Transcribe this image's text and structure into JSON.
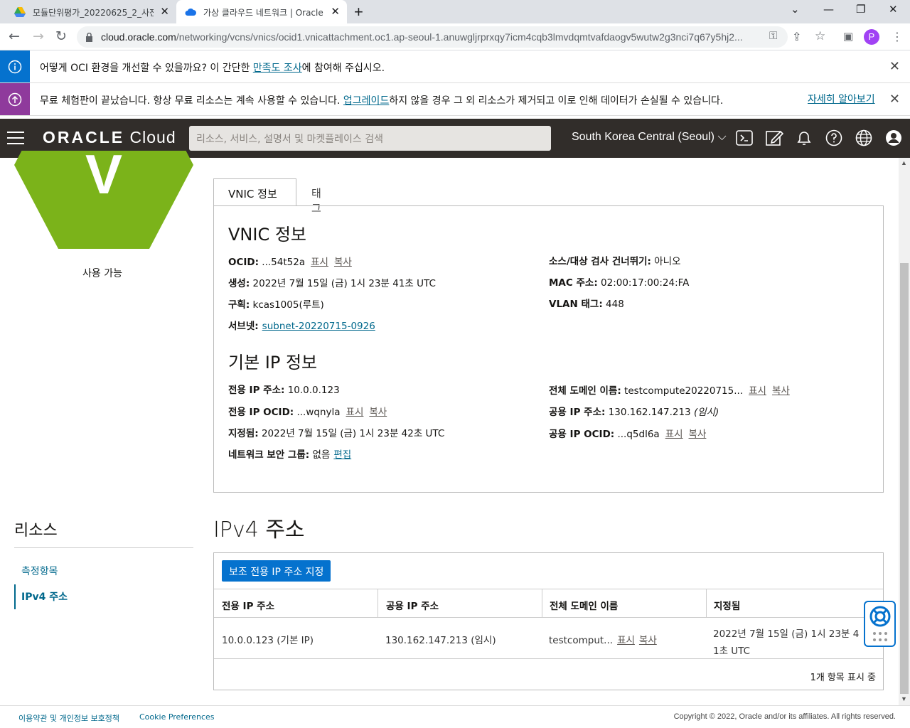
{
  "browser": {
    "tabs": [
      {
        "title": "모듈단위평가_20220625_2_사전"
      },
      {
        "title": "가상 클라우드 네트워크 | Oracle"
      }
    ],
    "url_host": "cloud.oracle.com",
    "url_rest": "/networking/vcns/vnics/ocid1.vnicattachment.oc1.ap-seoul-1.anuwgljrprxqy7icm4cqb3lmvdqmtvafdaogv5wutw2g3nci7q67y5hj2...",
    "profile_initial": "P"
  },
  "banners": {
    "survey": {
      "pre": "어떻게 OCI 환경을 개선할 수 있을까요? 이 간단한 ",
      "link": "만족도 조사",
      "post": "에 참여해 주십시오."
    },
    "trial": {
      "pre": "무료 체험판이 끝났습니다. 항상 무료 리소스는 계속 사용할 수 있습니다. ",
      "link": "업그레이드",
      "post": "하지 않을 경우 그 외 리소스가 제거되고 이로 인해 데이터가 손실될 수 있습니다.",
      "more": "자세히 알아보기"
    }
  },
  "header": {
    "logo_bold": "ORACLE",
    "logo_light": " Cloud",
    "search_placeholder": "리소스, 서비스, 설명서 및 마켓플레이스 검색",
    "region": "South Korea Central (Seoul)"
  },
  "sidebar": {
    "badge_letter": "V",
    "status": "사용 가능",
    "resources_title": "리소스",
    "items": [
      {
        "label": "측정항목"
      },
      {
        "label": "IPv4 주소"
      }
    ]
  },
  "detail_tabs": [
    {
      "label": "VNIC 정보"
    },
    {
      "label": "태그"
    }
  ],
  "vnic": {
    "title": "VNIC 정보",
    "ocid_label": "OCID:",
    "ocid": " ...54t52a",
    "show": "표시",
    "copy": "복사",
    "created_label": "생성:",
    "created": " 2022년 7월 15일 (금) 1시 23분 41초 UTC",
    "compartment_label": "구획:",
    "compartment": " kcas1005(루트)",
    "subnet_label": "서브넷:",
    "subnet": "subnet-20220715-0926",
    "skip_label": "소스/대상 검사 건너뛰기:",
    "skip": " 아니오",
    "mac_label": "MAC 주소:",
    "mac": " 02:00:17:00:24:FA",
    "vlan_label": "VLAN 태그:",
    "vlan": " 448"
  },
  "ip": {
    "title": "기본 IP 정보",
    "private_label": "전용 IP 주소:",
    "private": " 10.0.0.123",
    "private_ocid_label": "전용 IP OCID:",
    "private_ocid": " ...wqnyla",
    "assigned_label": "지정됨:",
    "assigned": " 2022년 7월 15일 (금) 1시 23분 42초 UTC",
    "nsg_label": "네트워크 보안 그룹:",
    "nsg": " 없음",
    "edit": "편집",
    "fqdn_label": "전체 도메인 이름:",
    "fqdn": " testcompute20220715...",
    "public_label": "공용 IP 주소:",
    "public": " 130.162.147.213 ",
    "public_note": "(임시)",
    "public_ocid_label": "공용 IP OCID:",
    "public_ocid": " ...q5dl6a"
  },
  "ipv4": {
    "title": "IPv4 주소",
    "button": "보조 전용 IP 주소 지정",
    "columns": [
      "전용 IP 주소",
      "공용 IP 주소",
      "전체 도메인 이름",
      "지정됨"
    ],
    "row": {
      "private": "10.0.0.123 (기본 IP)",
      "public": "130.162.147.213 (임시)",
      "fqdn": "testcomput...",
      "assigned_1": "2022년 7월 15일 (금) 1시 23분 4",
      "assigned_2": "1초 UTC"
    },
    "count": "1개 항목 표시 중"
  },
  "footer": {
    "terms": "이용약관 및 개인정보 보호정책",
    "cookies": "Cookie Preferences",
    "copyright": "Copyright © 2022, Oracle and/or its affiliates. All rights reserved."
  },
  "colors": {
    "accent": "#00688c",
    "button": "#0572ce",
    "header": "#312d2a",
    "hex": "#7bb31a",
    "info_bar": "#0572ce",
    "trial_bar": "#8f3a9c"
  }
}
